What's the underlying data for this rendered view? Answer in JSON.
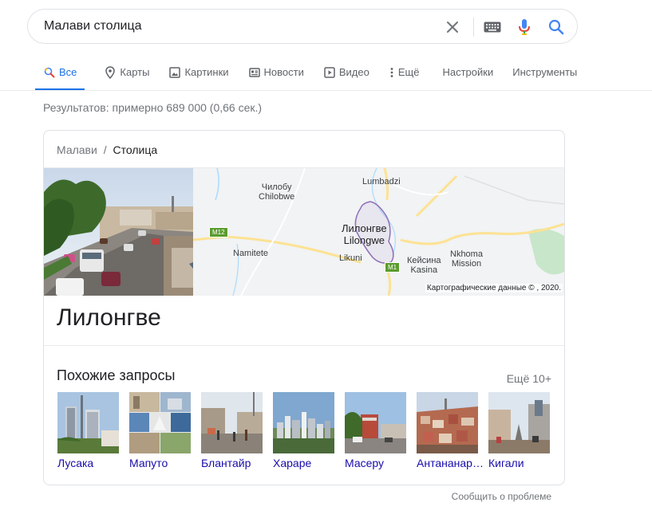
{
  "search": {
    "query": "Малави столица",
    "clear_icon": "close-icon",
    "keyboard_icon": "keyboard-icon",
    "voice_icon": "mic-icon",
    "search_icon": "search-icon"
  },
  "tabs": [
    {
      "label": "Все",
      "icon": "search-icon",
      "active": true
    },
    {
      "label": "Карты",
      "icon": "map-pin-icon"
    },
    {
      "label": "Картинки",
      "icon": "image-icon"
    },
    {
      "label": "Новости",
      "icon": "news-icon"
    },
    {
      "label": "Видео",
      "icon": "video-icon"
    },
    {
      "label": "Ещё",
      "icon": "more-vertical-icon"
    },
    {
      "label": "Настройки"
    },
    {
      "label": "Инструменты"
    }
  ],
  "result_stats": "Результатов: примерно 689 000 (0,66 сек.)",
  "card": {
    "breadcrumb": {
      "parent": "Малави",
      "separator": "/",
      "current": "Столица"
    },
    "map": {
      "labels": {
        "chilobu_ru": "Чилобу",
        "chilobu_en": "Chilobwe",
        "lumbadzi": "Lumbadzi",
        "city_ru": "Лилонгве",
        "city_en": "Lilongwe",
        "namitete": "Namitete",
        "likuni": "Likuni",
        "kasina_ru": "Кейсина",
        "kasina_en": "Kasina",
        "nkhoma_1": "Nkhoma",
        "nkhoma_2": "Mission",
        "road_m12": "M12",
        "road_m1": "M1"
      },
      "attribution": "Картографические данные © , 2020."
    },
    "title": "Лилонгве",
    "related": {
      "title": "Похожие запросы",
      "more": "Ещё 10+",
      "items": [
        "Лусака",
        "Мапуто",
        "Блантайр",
        "Хараре",
        "Масеру",
        "Антананариву",
        "Кигали"
      ]
    }
  },
  "feedback": "Сообщить о проблеме",
  "colors": {
    "accent": "#1a73e8",
    "link": "#1a0dab",
    "muted": "#70757a"
  }
}
